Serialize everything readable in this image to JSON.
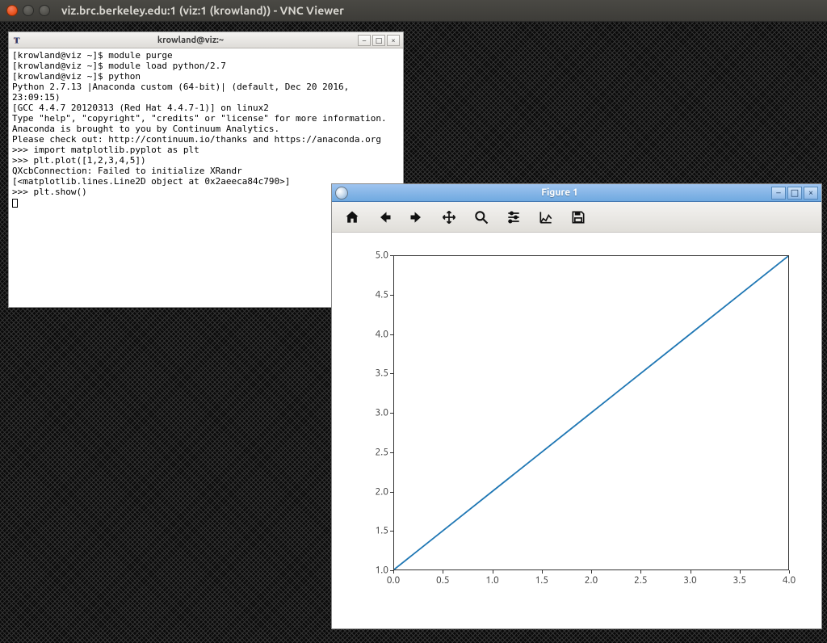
{
  "ubuntu": {
    "title": "viz.brc.berkeley.edu:1 (viz:1 (krowland)) - VNC Viewer"
  },
  "terminal": {
    "title": "krowland@viz:~",
    "lines": [
      "[krowland@viz ~]$ module purge",
      "[krowland@viz ~]$ module load python/2.7",
      "[krowland@viz ~]$ python",
      "Python 2.7.13 |Anaconda custom (64-bit)| (default, Dec 20 2016, 23:09:15)",
      "[GCC 4.4.7 20120313 (Red Hat 4.4.7-1)] on linux2",
      "Type \"help\", \"copyright\", \"credits\" or \"license\" for more information.",
      "Anaconda is brought to you by Continuum Analytics.",
      "Please check out: http://continuum.io/thanks and https://anaconda.org",
      ">>> import matplotlib.pyplot as plt",
      ">>> plt.plot([1,2,3,4,5])",
      "QXcbConnection: Failed to initialize XRandr",
      "[<matplotlib.lines.Line2D object at 0x2aeeca84c790>]",
      ">>> plt.show()"
    ]
  },
  "figure": {
    "title": "Figure 1"
  },
  "chart_data": {
    "type": "line",
    "x": [
      0,
      1,
      2,
      3,
      4
    ],
    "y": [
      1,
      2,
      3,
      4,
      5
    ],
    "xticks": [
      0.0,
      0.5,
      1.0,
      1.5,
      2.0,
      2.5,
      3.0,
      3.5,
      4.0
    ],
    "yticks": [
      1.0,
      1.5,
      2.0,
      2.5,
      3.0,
      3.5,
      4.0,
      4.5,
      5.0
    ],
    "xlim": [
      0,
      4
    ],
    "ylim": [
      1,
      5
    ],
    "xlabel": "",
    "ylabel": "",
    "title": ""
  }
}
